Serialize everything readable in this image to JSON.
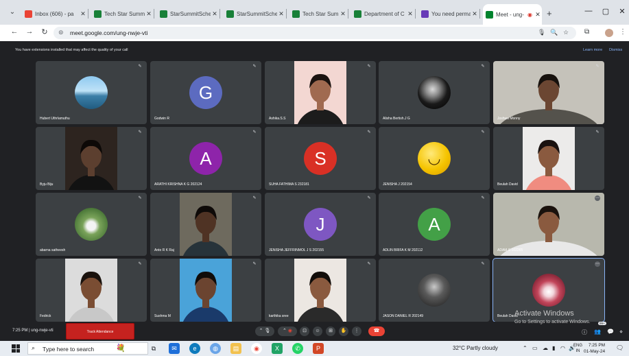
{
  "browser": {
    "tabs": [
      {
        "label": "Inbox (606) - pa",
        "icon": "gmail-icon",
        "color": "#ea4335"
      },
      {
        "label": "Tech Star Summi",
        "icon": "sheets-icon",
        "color": "#188038"
      },
      {
        "label": "StarSummitSche",
        "icon": "sheets-icon",
        "color": "#188038"
      },
      {
        "label": "StarSummitSche",
        "icon": "sheets-icon",
        "color": "#188038"
      },
      {
        "label": "Tech Star Summ",
        "icon": "sheets-icon",
        "color": "#188038"
      },
      {
        "label": "Department of C",
        "icon": "sheets-icon",
        "color": "#188038"
      },
      {
        "label": "You need perma",
        "icon": "forms-icon",
        "color": "#673ab7"
      },
      {
        "label": "Meet - ung-",
        "icon": "meet-icon",
        "color": "#00832d",
        "active": true
      }
    ],
    "url": "meet.google.com/ung-nwje-vti"
  },
  "notice": {
    "message": "You have extensions installed that may affect the quality of your call",
    "learn_more": "Learn more",
    "dismiss": "Dismiss"
  },
  "participants": [
    {
      "name": "Hubert Uthrlamuthu",
      "kind": "photo",
      "photo": "landscape"
    },
    {
      "name": "Godwin R",
      "kind": "letter",
      "letter": "G",
      "color": "#5c6bc0"
    },
    {
      "name": "Ashika.S.S",
      "kind": "video",
      "bg": "#f3d7d2",
      "skin": "#a06a50",
      "hair": "#1b1310",
      "shirt": "#1c1c1c"
    },
    {
      "name": "Alisha Bertish.J G",
      "kind": "photo",
      "photo": "dark"
    },
    {
      "name": "Joshwa Monny",
      "kind": "video_wide",
      "bg": "#c5c2ba",
      "skin": "#6b4632",
      "hair": "#17110d",
      "shirt": "#54524c"
    },
    {
      "name": "Byju Biju",
      "kind": "video",
      "bg": "#2d241f",
      "skin": "#5c3f2f",
      "hair": "#0d0907",
      "shirt": "#121212"
    },
    {
      "name": "ARATHI KRISHNA K G 202124",
      "kind": "letter",
      "letter": "A",
      "color": "#8e24aa"
    },
    {
      "name": "SUHA FATHIMA S 232181",
      "kind": "letter",
      "letter": "S",
      "color": "#d93025"
    },
    {
      "name": "JENISHA J 202154",
      "kind": "emoji"
    },
    {
      "name": "Beulah David",
      "kind": "video",
      "bg": "#ecebea",
      "skin": "#8a5a3f",
      "hair": "#1a1210",
      "shirt": "#f08c80"
    },
    {
      "name": "abarna satheesh",
      "kind": "photo",
      "photo": "outdoor"
    },
    {
      "name": "Anto R K Raj",
      "kind": "video",
      "bg": "#6e6a5e",
      "skin": "#4f3324",
      "hair": "#0e0a08",
      "shirt": "#27333a"
    },
    {
      "name": "JENISHA JEFFRINMOL J S 202155",
      "kind": "letter",
      "letter": "J",
      "color": "#7e57c2"
    },
    {
      "name": "ADLIN BRIFA K M 202112",
      "kind": "letter",
      "letter": "A",
      "color": "#43a047"
    },
    {
      "name": "ADAM S 102265",
      "kind": "video_wide",
      "bg": "#b8b8ad",
      "skin": "#8a5a3f",
      "hair": "#1a120d",
      "shirt": "#e8e8e8",
      "badge": true
    },
    {
      "name": "Fedrick",
      "kind": "video",
      "bg": "#dcdcdc",
      "skin": "#7a4d33",
      "hair": "#1a120d",
      "shirt": "#c8c8c8"
    },
    {
      "name": "Sushma M",
      "kind": "video",
      "bg": "#4aa3d9",
      "skin": "#6b4430",
      "hair": "#100c0a",
      "shirt": "#1a3a6a"
    },
    {
      "name": "karthika sree",
      "kind": "video",
      "bg": "#ece7e2",
      "skin": "#8a5a3f",
      "hair": "#120d0a",
      "shirt": "#2a2a2a"
    },
    {
      "name": "JASON DANIEL R 202149",
      "kind": "photo",
      "photo": "bw"
    },
    {
      "name": "Beulah David",
      "kind": "photo",
      "photo": "flowers",
      "selected": true,
      "badge": true
    }
  ],
  "bottom": {
    "meeting_info": "7:25 PM  |  ung-nwje-vti",
    "attendance_button": "Track Attendance",
    "badge_count": "99+"
  },
  "watermark": {
    "line1": "Activate Windows",
    "line2": "Go to Settings to activate Windows."
  },
  "taskbar": {
    "search_placeholder": "Type here to search",
    "weather": "32°C  Partly cloudy",
    "lang1": "ENG",
    "lang2": "IN",
    "time": "7:25 PM",
    "date": "01-May-24"
  },
  "colors": {
    "meet_bg": "#202124",
    "tile_bg": "#3c4043",
    "end_call": "#ea4335",
    "attendance": "#c5221f"
  }
}
